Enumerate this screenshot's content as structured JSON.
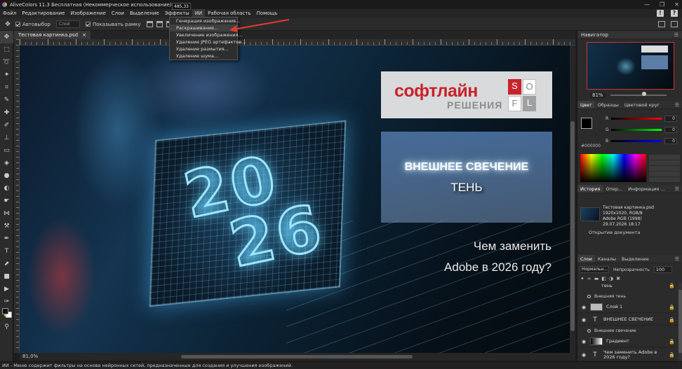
{
  "window": {
    "title": "AliveColors 11.3 Бесплатная (Некоммерческое использование)",
    "controls": [
      "—",
      "❐",
      "✕"
    ]
  },
  "menu": {
    "items": [
      "Файл",
      "Редактирование",
      "Изображение",
      "Слои",
      "Выделение",
      "Эффекты",
      "ИИ",
      "Рабочая область",
      "Помощь"
    ],
    "active_index": 6,
    "coord_tooltip": "485,33"
  },
  "ai_menu": {
    "items": [
      "Генерация изображения...",
      "Раскрашивание...",
      "Увеличение изображения...",
      "Удаление JPEG артефактов...",
      "Удаление размытия...",
      "Удаление шума..."
    ],
    "highlighted_index": 1
  },
  "options": {
    "autoselect_label": "Автовыбор",
    "layer_select": "Слой",
    "show_frame_label": "Показывать рамку"
  },
  "document": {
    "tab_title": "Тестовая картинка.psd",
    "tab_close": "×",
    "zoom": "81,0%"
  },
  "canvas": {
    "logo_word": "софтлайн",
    "logo_sub": "РЕШЕНИЯ",
    "logo_letters": [
      "S",
      "O",
      "F",
      "L"
    ],
    "glow_text": "ВНЕШНЕЕ СВЕЧЕНИЕ",
    "shadow_text": "ТЕНЬ",
    "number_top": "20",
    "number_bottom": "26",
    "question_line1": "Чем заменить",
    "question_line2": "Adobe в 2026 году?",
    "colors": {
      "logo_red": "#c8232c",
      "logo_gray": "#8a8c8e",
      "glow": "#9fe6ff"
    }
  },
  "navigator": {
    "title": "Навигатор",
    "zoom": "81%"
  },
  "color_panel": {
    "tabs": [
      "Цвет",
      "Образцы",
      "Цветовой круг"
    ],
    "hex": "#000000",
    "r_label": "R",
    "g_label": "G",
    "b_label": "B",
    "r": "0",
    "g": "0",
    "b": "0"
  },
  "history_panel": {
    "tabs": [
      "История",
      "Опер...",
      "Информация ..."
    ],
    "doc_name": "Тестовая картинка.psd",
    "doc_size": "1920x1020, RGB/8",
    "doc_profile": "Adobe RGB (1998)",
    "doc_date": "29.07.2026 18:17",
    "state": "Открытие документа"
  },
  "layers_panel": {
    "tabs": [
      "Слои",
      "Каналы",
      "Выделение"
    ],
    "blend_mode": "Нормальн...",
    "opacity_label": "Непрозрачность",
    "opacity": "100",
    "partial_top": "тень",
    "fx_shadow": "Внешняя тень",
    "layer1": "Слой 1",
    "layer_glow": "ВНЕШНЕЕ СВЕЧЕНИЕ",
    "fx_glow": "Внешнее свечение",
    "layer_gradient": "Градиент",
    "layer_question": "Чем заменить Adobe в 2026 году?"
  },
  "status": {
    "text": "ИИ - Меню содержит фильтры на основе нейронных сетей, предназначенные для создания и улучшения изображений."
  }
}
